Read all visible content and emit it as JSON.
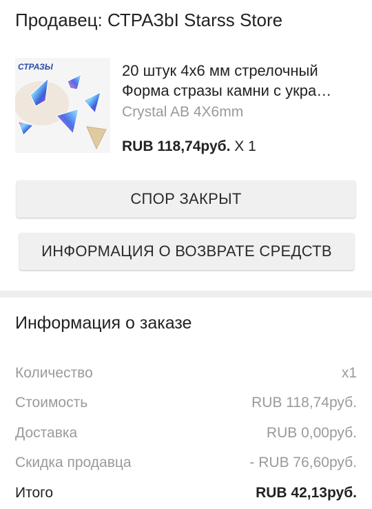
{
  "seller": {
    "title": "Продавец: СТРАЗbI Starss Store"
  },
  "product": {
    "image_label": "СТРАЗЫ",
    "name_line1": "20 штук 4x6 мм стрелочный",
    "name_line2": "Форма стразы камни с укра…",
    "variant": "Crystal AB 4X6mm",
    "price": "RUB 118,74руб.",
    "quantity": "X 1"
  },
  "buttons": {
    "dispute_closed": "СПОР ЗАКРЫТ",
    "refund_info": "ИНФОРМАЦИЯ О ВОЗВРАТЕ СРЕДСТВ"
  },
  "order_info": {
    "heading": "Информация о заказе",
    "rows": [
      {
        "label": "Количество",
        "value": "x1"
      },
      {
        "label": "Стоимость",
        "value": "RUB 118,74руб."
      },
      {
        "label": "Доставка",
        "value": "RUB 0,00руб."
      },
      {
        "label": "Скидка продавца",
        "value": "- RUB 76,60руб."
      }
    ],
    "total": {
      "label": "Итого",
      "value": "RUB 42,13руб."
    }
  }
}
